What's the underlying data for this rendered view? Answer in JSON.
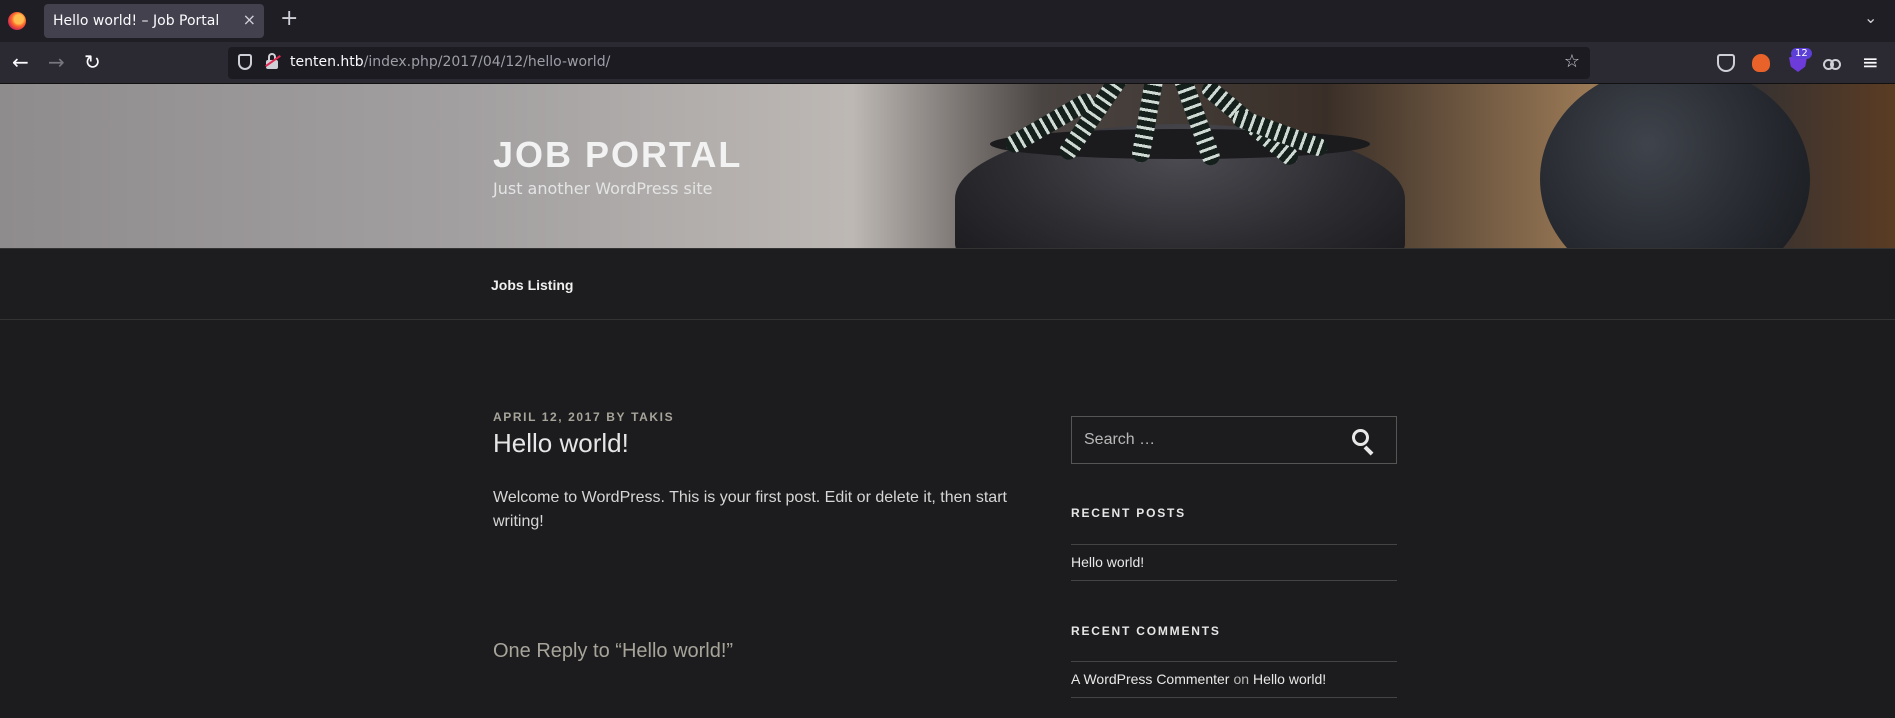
{
  "browser": {
    "tab_title": "Hello world! – Job Portal",
    "tab_close": "×",
    "new_tab": "+",
    "tablist": "⌄",
    "url_host": "tenten.htb",
    "url_path": "/index.php/2017/04/12/hello-world/",
    "extension_badge": "12",
    "icons": {
      "back": "←",
      "forward": "→",
      "reload": "↻",
      "star": "☆",
      "menu": "≡"
    }
  },
  "site": {
    "title": "Job Portal",
    "description": "Just another WordPress site"
  },
  "menu": {
    "items": [
      {
        "label": "Jobs Listing"
      }
    ]
  },
  "post": {
    "date": "April 12, 2017",
    "by": "by",
    "author": "Takis",
    "title": "Hello world!",
    "content": "Welcome to WordPress. This is your first post. Edit or delete it, then start writing!",
    "comments_title": "One Reply to “Hello world!”"
  },
  "sidebar": {
    "search_placeholder": "Search …",
    "recent_posts_title": "Recent Posts",
    "recent_posts": [
      {
        "label": "Hello world!"
      }
    ],
    "recent_comments_title": "Recent Comments",
    "recent_comments": [
      {
        "author": "A WordPress Commenter",
        "on": "on",
        "post": "Hello world!"
      }
    ]
  }
}
